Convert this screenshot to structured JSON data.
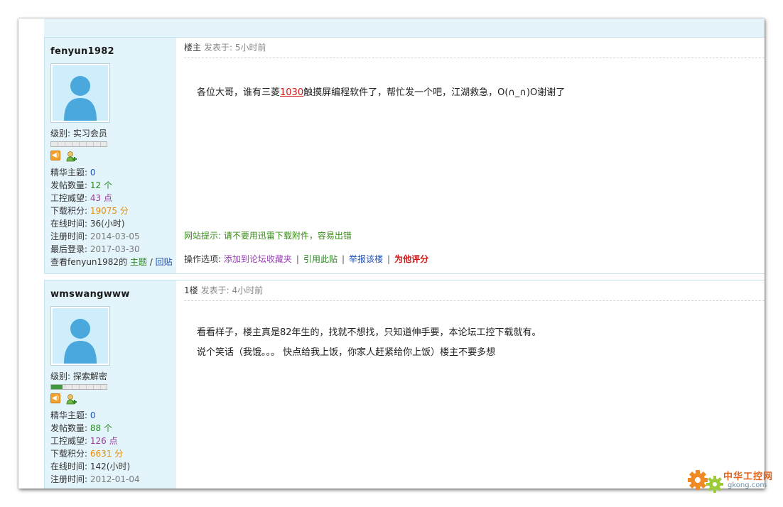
{
  "posts": [
    {
      "author": "fenyun1982",
      "level_label": "级别:",
      "level_name": "实习会员",
      "level_progress": 0,
      "stats": {
        "elite_label": "精华主题:",
        "elite": "0",
        "posts_label": "发帖数量:",
        "posts": "12 个",
        "prestige_label": "工控威望:",
        "prestige": "43 点",
        "points_label": "下载积分:",
        "points": "19075 分",
        "online_label": "在线时间:",
        "online": "36(小时)",
        "registered_label": "注册时间:",
        "registered": "2014-03-05",
        "last_login_label": "最后登录:",
        "last_login": "2017-03-30",
        "view_prefix": "查看fenyun1982的",
        "view_topics": "主题",
        "view_sep": "/",
        "view_replies": "回贴"
      },
      "floor": "楼主",
      "posted_label": "发表于: 5小时前",
      "text_before": "各位大哥，谁有三菱",
      "keyword": "1030",
      "text_after": "触摸屏编程软件了，帮忙发一个吧，江湖救急，O(∩_∩)O谢谢了",
      "tip": "网站提示: 请不要用迅雷下载附件，容易出错",
      "ops_label": "操作选项:",
      "op_fav": "添加到论坛收藏夹",
      "op_sep": "|",
      "op_quote": "引用此贴",
      "op_report": "举报该楼",
      "op_rate": "为他评分"
    },
    {
      "author": "wmswangwww",
      "level_label": "级别:",
      "level_name": "探索解密",
      "level_progress": 0.2,
      "stats": {
        "elite_label": "精华主题:",
        "elite": "0",
        "posts_label": "发帖数量:",
        "posts": "88 个",
        "prestige_label": "工控威望:",
        "prestige": "126 点",
        "points_label": "下载积分:",
        "points": "6631 分",
        "online_label": "在线时间:",
        "online": "142(小时)",
        "registered_label": "注册时间:",
        "registered": "2012-01-04"
      },
      "floor": "1楼",
      "posted_label": "发表于: 4小时前",
      "line1": "看看样子，楼主真是82年生的，找就不想找，只知道伸手要，本论坛工控下载就有。",
      "line2": "说个笑话（我饿。。。 快点给我上饭，你家人赶紧给你上饭）楼主不要多想"
    }
  ],
  "watermark": {
    "name": "中华工控网",
    "url": "gkong.com"
  },
  "colors": {
    "sidebar_bg": "#e4f4fb",
    "border": "#c4e3ee",
    "link_blue": "#1d52b8",
    "tip_green": "#3b8a1b"
  }
}
